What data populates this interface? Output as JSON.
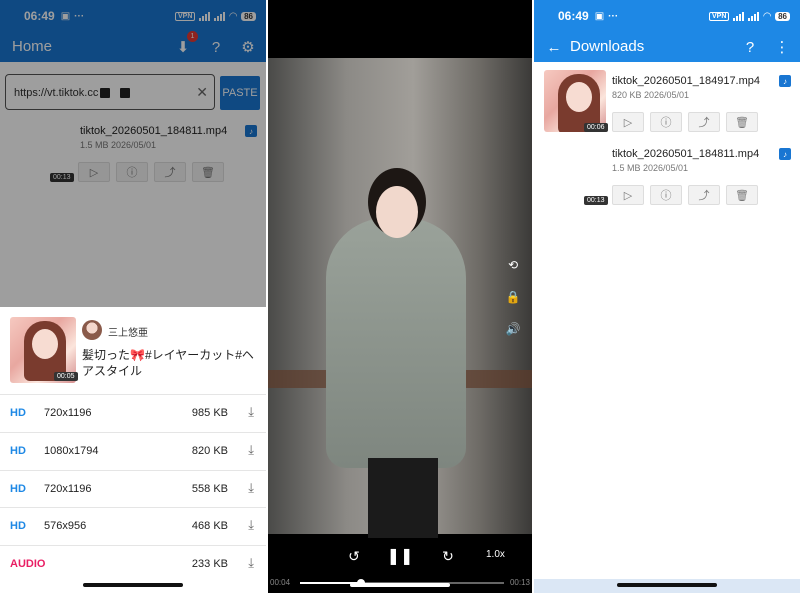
{
  "status_bar": {
    "time": "06:49",
    "extra": "···",
    "vpn": "VPN",
    "battery": "86"
  },
  "panel1": {
    "appbar": {
      "title": "Home",
      "notif_count": "1"
    },
    "url": {
      "value": "https://vt.tiktok.cc"
    },
    "paste_label": "PASTE",
    "item": {
      "name": "tiktok_20260501_184811.mp4",
      "meta": "1.5 MB 2026/05/01",
      "duration": "00:13"
    },
    "sheet": {
      "author": "三上悠亜",
      "caption": "髪切った🎀#レイヤーカット#ヘアスタイル",
      "duration": "00:05",
      "formats": [
        {
          "quality": "HD",
          "resolution": "720x1196",
          "size": "985 KB"
        },
        {
          "quality": "HD",
          "resolution": "1080x1794",
          "size": "820 KB"
        },
        {
          "quality": "HD",
          "resolution": "720x1196",
          "size": "558 KB"
        },
        {
          "quality": "HD",
          "resolution": "576x956",
          "size": "468 KB"
        },
        {
          "quality": "AUDIO",
          "resolution": "",
          "size": "233 KB"
        }
      ]
    }
  },
  "panel2": {
    "speed": "1.0x",
    "time_current": "00:04",
    "time_total": "00:13",
    "progress": 0.3
  },
  "panel3": {
    "appbar": {
      "title": "Downloads"
    },
    "items": [
      {
        "name": "tiktok_20260501_184917.mp4",
        "meta": "820 KB 2026/05/01",
        "duration": "00:06"
      },
      {
        "name": "tiktok_20260501_184811.mp4",
        "meta": "1.5 MB 2026/05/01",
        "duration": "00:13"
      }
    ]
  },
  "colors": {
    "primary": "#1976d2",
    "primary_light": "#1e88e5",
    "audio": "#e91e63"
  }
}
